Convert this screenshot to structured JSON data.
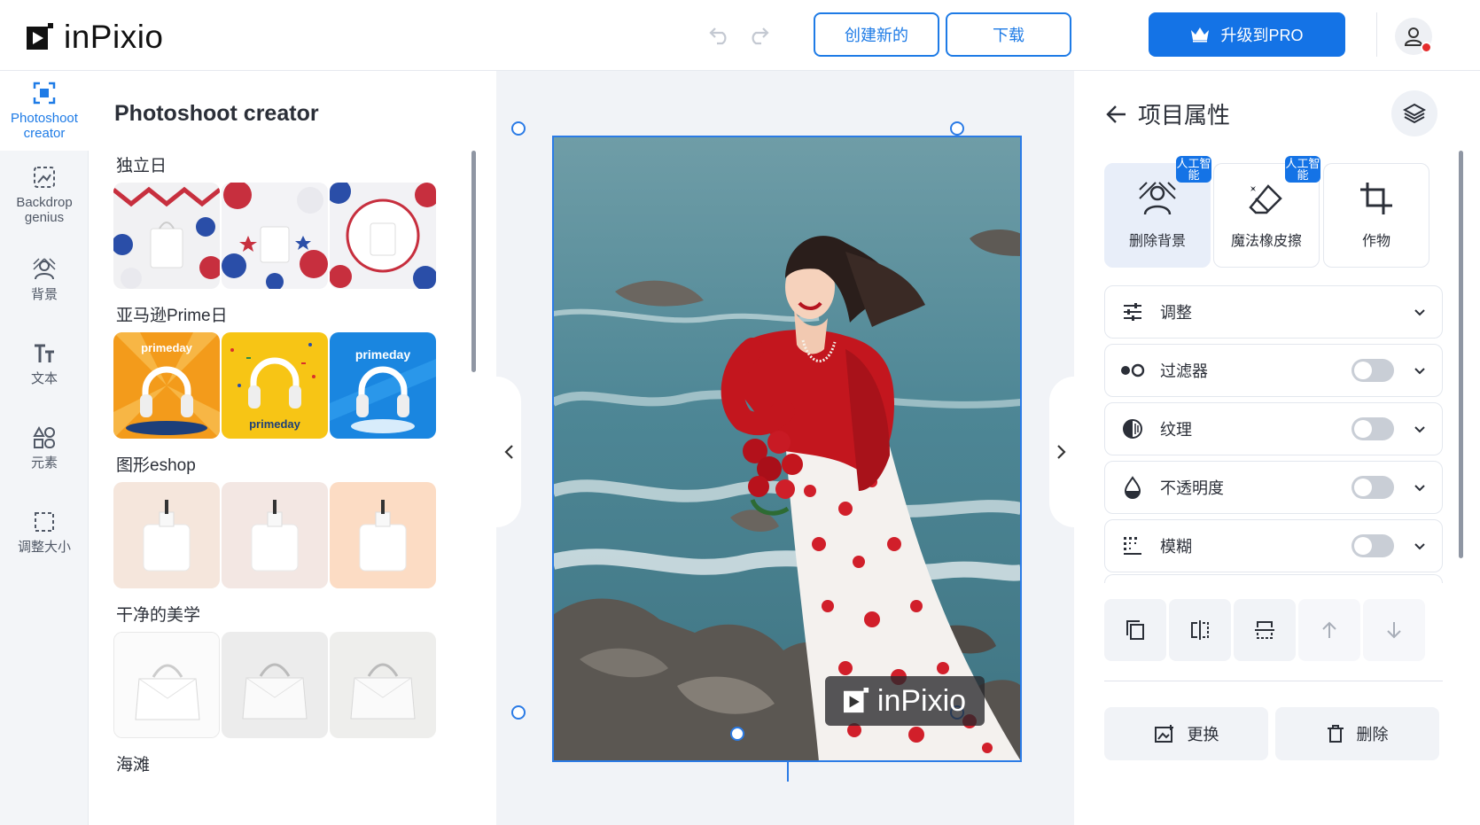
{
  "app": {
    "logo_text": "inPixio"
  },
  "header": {
    "create_new_label": "创建新的",
    "download_label": "下载",
    "upgrade_label": "升级到PRO",
    "colors": {
      "accent": "#1473e6",
      "outline": "#1e7be6"
    }
  },
  "rail": {
    "items": [
      {
        "label": "Photoshoot creator",
        "icon": "photoshoot-icon",
        "active": true
      },
      {
        "label": "Backdrop genius",
        "icon": "backdrop-icon"
      },
      {
        "label": "背景",
        "icon": "background-icon"
      },
      {
        "label": "文本",
        "icon": "text-icon"
      },
      {
        "label": "元素",
        "icon": "elements-icon"
      },
      {
        "label": "调整大小",
        "icon": "resize-icon"
      }
    ]
  },
  "gallery": {
    "title": "Photoshoot creator",
    "categories": [
      {
        "label": "独立日",
        "thumbs": [
          "independence-day-1",
          "independence-day-2",
          "independence-day-3"
        ]
      },
      {
        "label": "亚马逊Prime日",
        "thumbs": [
          "primeday-orange",
          "primeday-yellow",
          "primeday-blue"
        ],
        "thumb_texts": [
          "primeday",
          "primeday",
          "primeday"
        ]
      },
      {
        "label": "图形eshop",
        "thumbs": [
          "bottle-beige",
          "bottle-pink",
          "bottle-peach"
        ]
      },
      {
        "label": "干净的美学",
        "thumbs": [
          "bag-white",
          "bag-grey",
          "bag-light"
        ]
      },
      {
        "label": "海滩"
      }
    ]
  },
  "canvas": {
    "watermark_text": "inPixio"
  },
  "props": {
    "title": "项目属性",
    "tools": [
      {
        "label": "删除背景",
        "badge": "人工智能",
        "icon": "remove-bg-icon",
        "active": true
      },
      {
        "label": "魔法橡皮擦",
        "badge": "人工智能",
        "icon": "magic-eraser-icon"
      },
      {
        "label": "作物",
        "icon": "crop-icon"
      }
    ],
    "adjust_label": "调整",
    "filter_label": "过滤器",
    "texture_label": "纹理",
    "opacity_label": "不透明度",
    "blur_label": "模糊",
    "replace_label": "更换",
    "delete_label": "删除"
  }
}
